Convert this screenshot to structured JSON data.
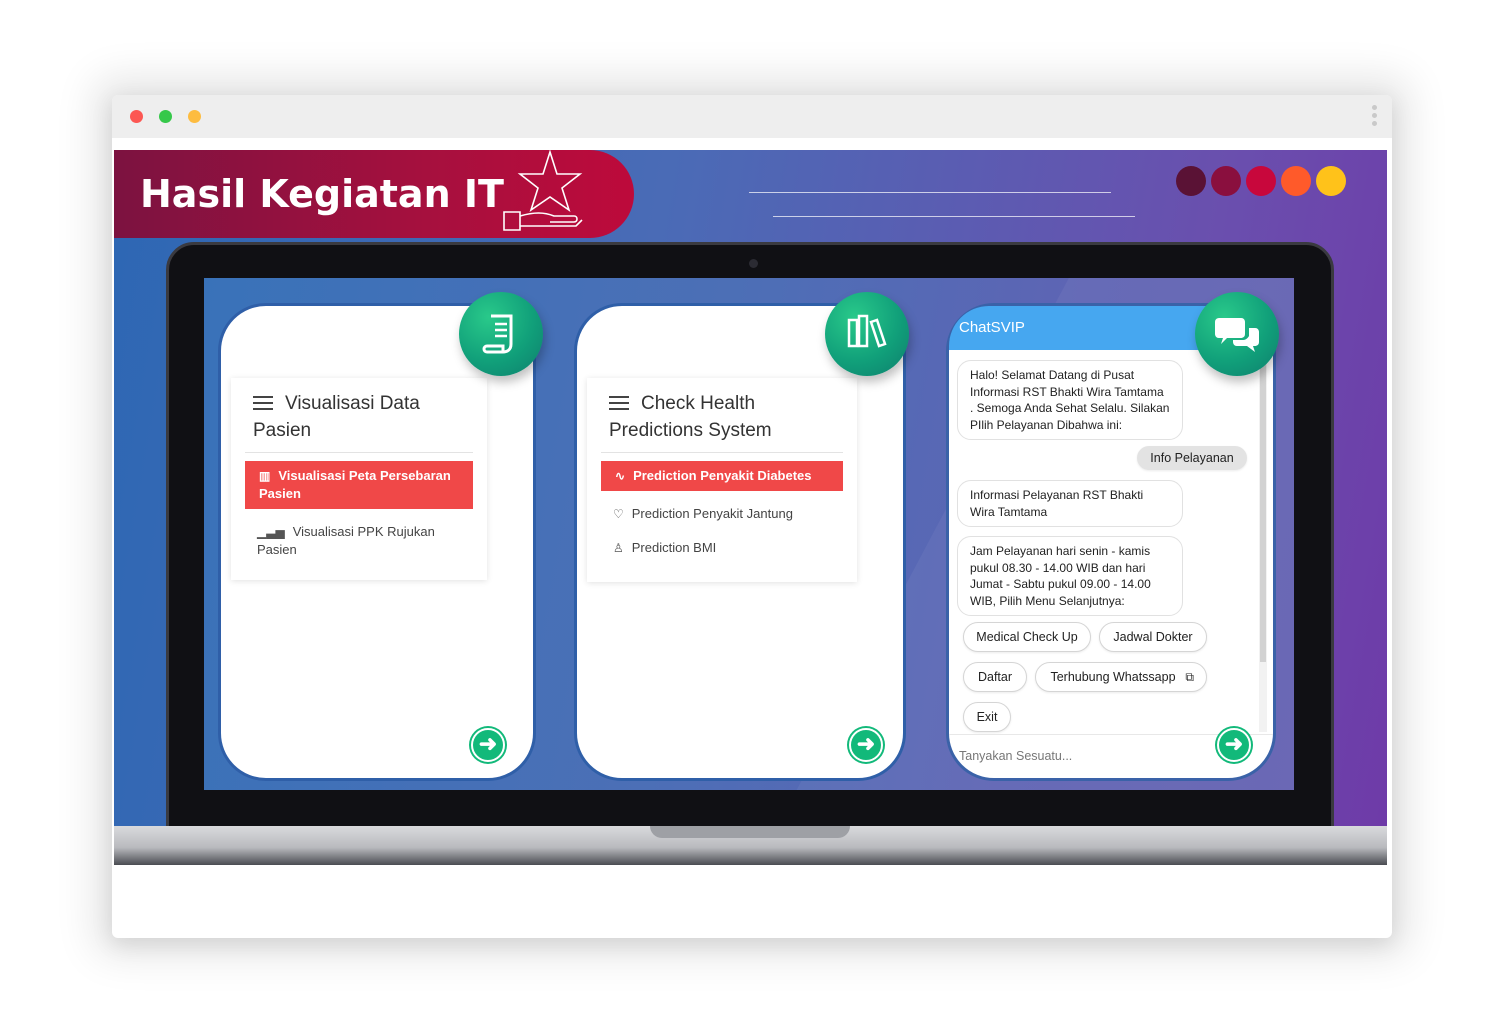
{
  "window": {
    "traffic_lights": [
      "red",
      "green",
      "yellow"
    ],
    "menu_icon": "kebab-icon"
  },
  "banner": {
    "title": "Hasil Kegiatan IT",
    "icon": "star-hand-icon",
    "circle_colors": [
      "#5a1235",
      "#8a0f3e",
      "#c8073c",
      "#ff5a2a",
      "#ffc21a"
    ]
  },
  "cards": [
    {
      "badge_icon": "scroll-icon",
      "menu_title": "Visualisasi Data Pasien",
      "active_item": "Visualisasi Peta Persebaran Pasien",
      "items": [
        "Visualisasi PPK Rujukan Pasien"
      ],
      "item_icons": [
        "map-icon",
        "bar-chart-icon"
      ]
    },
    {
      "badge_icon": "books-icon",
      "menu_title": "Check Health Predictions System",
      "active_item": "Prediction Penyakit Diabetes",
      "items": [
        "Prediction Penyakit Jantung",
        "Prediction BMI"
      ],
      "item_icons": [
        "pulse-icon",
        "heart-icon",
        "user-icon"
      ]
    }
  ],
  "chat": {
    "title": "ChatSVIP",
    "badge_icon": "chat-bubbles-icon",
    "bot_messages": [
      "Halo! Selamat Datang di Pusat Informasi RST Bhakti Wira Tamtama . Semoga Anda Sehat Selalu. Silakan PIlih Pelayanan Dibahwa ini:",
      "Informasi Pelayanan RST Bhakti Wira Tamtama",
      "Jam Pelayanan hari senin - kamis pukul 08.30 - 14.00 WIB dan hari Jumat - Sabtu pukul 09.00 - 14.00 WIB, Pilih Menu Selanjutnya:"
    ],
    "user_message": "Info Pelayanan",
    "options": [
      "Medical Check Up",
      "Jadwal Dokter",
      "Daftar",
      "Terhubung Whatssapp",
      "Exit"
    ],
    "input_placeholder": "Tanyakan Sesuatu..."
  }
}
